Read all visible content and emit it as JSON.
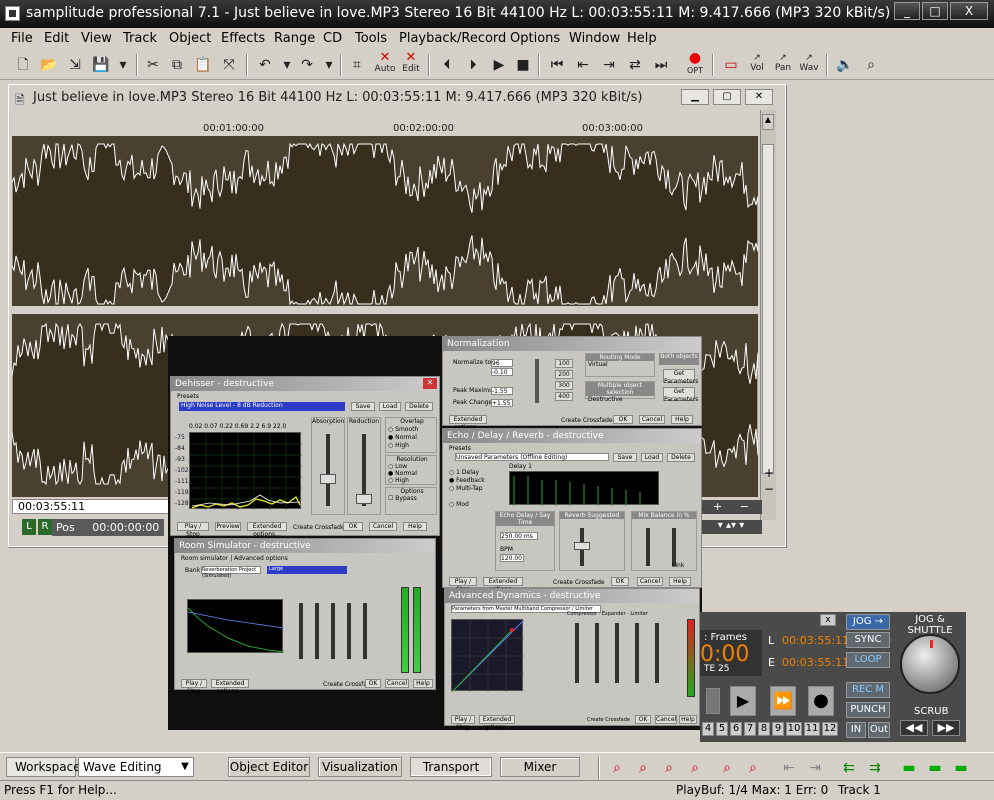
{
  "window": {
    "title": "samplitude professional 7.1 - Just believe in love.MP3  Stereo 16 Bit 44100 Hz L: 00:03:55:11 M: 9.417.666  (MP3 320 kBit/s)",
    "min": "_",
    "max": "□",
    "close": "X"
  },
  "menu": [
    "File",
    "Edit",
    "View",
    "Track",
    "Object",
    "Effects",
    "Range",
    "CD",
    "Tools",
    "Playback/Record",
    "Options",
    "Window",
    "Help"
  ],
  "toolbar": {
    "auto_label": "Auto",
    "edit_label": "Edit",
    "opt_label": "OPT",
    "vol_label": "Vol",
    "pan_label": "Pan",
    "wav_label": "Wav"
  },
  "wavewin": {
    "title": "Just believe in love.MP3  Stereo 16 Bit 44100 Hz L: 00:03:55:11 M: 9.417.666  (MP3 320 kBit/s)",
    "ruler": [
      "00:01:00:00",
      "00:02:00:00",
      "00:03:00:00"
    ],
    "timecode": "00:03:55:11",
    "left_btn": "L",
    "right_btn": "R",
    "pos_label": "Pos",
    "pos_value": "00:00:00:00",
    "plus": "+",
    "minus": "−"
  },
  "plugins": {
    "deesser": {
      "title": "Dehisser - destructive",
      "preset_label": "Presets",
      "preset": "High Noise Level - 8 dB Reduction",
      "save": "Save",
      "load": "Load",
      "delete": "Delete",
      "scale": [
        "-75",
        "-84",
        "-93",
        "-102",
        "-111",
        "-119",
        "-128"
      ],
      "freq": "0.02  0.07  0.22  0.69  2.2  6.9  22.0",
      "absorption": "Absorption",
      "reduction": "Reduction",
      "overlap": "Overlap",
      "smooth": "Smooth",
      "normal": "Normal",
      "high": "High",
      "resolution": "Resolution",
      "low": "Low",
      "options": "Options",
      "bypass": "Bypass",
      "buttons": [
        "Play / Stop",
        "Preview",
        "Extended options...",
        "Create Crossfade",
        "OK",
        "Cancel",
        "Help"
      ]
    },
    "room": {
      "title": "Room Simulator - destructive",
      "tabs": [
        "Room simulator",
        "Advanced options"
      ],
      "bank_label": "Bank",
      "bank": "Reverberation Project (Simulated)",
      "preset": "Large",
      "buttons": [
        "Play / Stop",
        "Extended options...",
        "Create Crossfade",
        "OK",
        "Cancel",
        "Help"
      ]
    },
    "normalize": {
      "title": "Normalization",
      "rows": [
        "Normalize to:",
        "Peak Maximum",
        "Peak Change"
      ],
      "values": [
        "96",
        "-0.10",
        "-1.55",
        "+1.55"
      ],
      "group1": "Routing Mode",
      "group2": "Multiple object selection",
      "group3": "Both objects",
      "opts": [
        "Virtual",
        "Destructive"
      ],
      "btns": [
        "100",
        "200",
        "300",
        "400"
      ],
      "side_btns": [
        "Get Parameters",
        "Get Parameters"
      ],
      "buttons": [
        "Extended options...",
        "Create Crossfade",
        "OK",
        "Cancel",
        "Help"
      ]
    },
    "echo": {
      "title": "Echo / Delay / Reverb - destructive",
      "preset_label": "Presets",
      "preset": "Unsaved Parameters (Offline Editing)",
      "save": "Save",
      "load": "Load",
      "delete": "Delete",
      "delay_label": "Delay 1",
      "opts": [
        "1 Delay",
        "Feedback",
        "Multi-Tap",
        "Mod"
      ],
      "sections": [
        "Echo Delay / Say Time",
        "Reverb Suggested",
        "Mix Balance in %"
      ],
      "bpm_label": "BPM",
      "value_1": "250.00 ms",
      "value_2": "120.00",
      "link": "Link",
      "buttons": [
        "Play / Stop",
        "Extended options...",
        "Create Crossfade",
        "OK",
        "Cancel",
        "Help"
      ]
    },
    "dyn": {
      "title": "Advanced Dynamics - destructive",
      "preset_label": "Presets",
      "preset": "Parameters from Master Multiband Compressor / Limiter",
      "tabs": [
        "Compressor",
        "Expander",
        "Limiter"
      ],
      "buttons": [
        "Play / Stop",
        "Extended options...",
        "Create Crossfade",
        "OK",
        "Cancel",
        "Help"
      ]
    }
  },
  "transport": {
    "close": "x",
    "jog_btn": "JOG →",
    "jog_title": "JOG & SHUTTLE",
    "frames": ": Frames",
    "time": "0:00",
    "fps": "TE 25",
    "l_label": "L",
    "l_value": "00:03:55:11",
    "e_label": "E",
    "e_value": "00:03:55:11",
    "sync": "SYNC",
    "loop": "LOOP",
    "recm": "REC M",
    "punch": "PUNCH",
    "in": "IN",
    "out": "Out",
    "scrub": "SCRUB",
    "numbers": [
      "4",
      "5",
      "6",
      "7",
      "8",
      "9",
      "10",
      "11",
      "12"
    ]
  },
  "workspace": {
    "label": "Workspace:",
    "value": "Wave Editing",
    "buttons": [
      "Object Editor",
      "Visualization",
      "Transport",
      "Mixer"
    ]
  },
  "statusbar": {
    "help": "Press F1 for Help...",
    "playbuf": "PlayBuf: 1/4 Max: 1 Err: 0",
    "track": "Track 1"
  }
}
